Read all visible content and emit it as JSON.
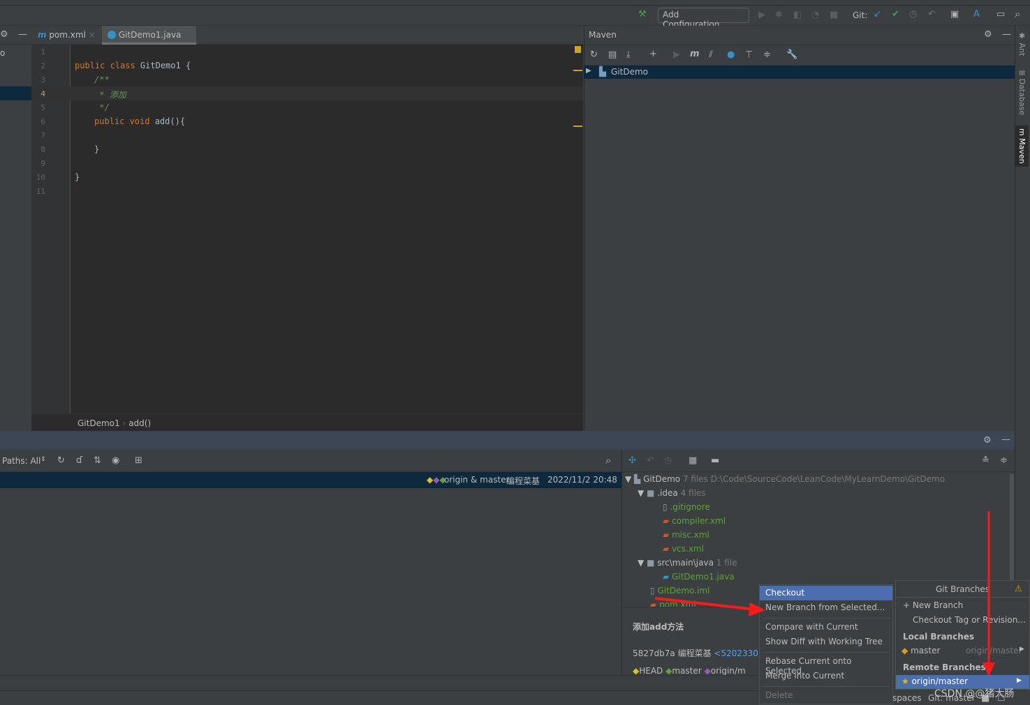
{
  "toolbar": {
    "add_configuration": "Add Configuration...",
    "git_label": "Git:"
  },
  "editor": {
    "tabs": [
      {
        "label": "pom.xml",
        "icon": "maven-icon"
      },
      {
        "label": "GitDemo1.java",
        "icon": "class-icon"
      }
    ],
    "line_numbers": [
      "1",
      "2",
      "3",
      "4",
      "5",
      "6",
      "7",
      "8",
      "9",
      "10",
      "11"
    ],
    "code": {
      "l2_kw": "public class",
      "l2_name": " GitDemo1 {",
      "l3": "/**",
      "l4": " * 添加",
      "l5": " */",
      "l6_kw": "public void",
      "l6_name": " add(){",
      "l8": "}",
      "l10": "}"
    },
    "breadcrumb": [
      "GitDemo1",
      "add()"
    ],
    "left_panel_fragment": "o"
  },
  "maven": {
    "title": "Maven",
    "tree_root": "GitDemo"
  },
  "right_sidebar": [
    "Ant",
    "Database",
    "Maven"
  ],
  "git_log": {
    "paths_filter": "Paths: All",
    "row": {
      "refs": "origin & master",
      "author": "编程菜基",
      "date": "2022/11/2 20:48"
    }
  },
  "changed_files": {
    "root": {
      "name": "GitDemo",
      "count": "7 files",
      "path": "D:\\Code\\SourceCode\\LeanCode\\MyLearnDemo\\GitDemo"
    },
    "idea": {
      "name": ".idea",
      "count": "4 files"
    },
    "idea_files": [
      ".gitignore",
      "compiler.xml",
      "misc.xml",
      "vcs.xml"
    ],
    "src": {
      "name": "src\\main\\java",
      "count": "1 file"
    },
    "src_files": [
      "GitDemo1.java"
    ],
    "root_files": [
      "GitDemo.iml",
      "pom.xml"
    ]
  },
  "commit_details": {
    "message": "添加add方法",
    "hash_author": "5827db7a 编程菜基",
    "email": "<5202330+",
    "tags": [
      "HEAD",
      "master",
      "origin/m"
    ]
  },
  "context_menu": {
    "items": [
      "Checkout",
      "New Branch from Selected...",
      "Compare with Current",
      "Show Diff with Working Tree",
      "Rebase Current onto Selected",
      "Merge into Current",
      "Delete"
    ],
    "highlighted": "Checkout"
  },
  "git_branches": {
    "title": "Git Branches",
    "new_branch": "New Branch",
    "checkout_tag": "Checkout Tag or Revision...",
    "local_header": "Local Branches",
    "local": [
      {
        "name": "master",
        "tracking": "origin/master"
      }
    ],
    "remote_header": "Remote Branches",
    "remote": [
      {
        "name": "origin/master",
        "selected": true
      }
    ]
  },
  "status_bar": {
    "spaces": "spaces",
    "git": "Git: master"
  },
  "watermark": "CSDN @@猪大肠",
  "colors": {
    "accent": "#4b6eaf",
    "selection": "#0d293e",
    "annotation_arrow": "#ff1a1a"
  }
}
